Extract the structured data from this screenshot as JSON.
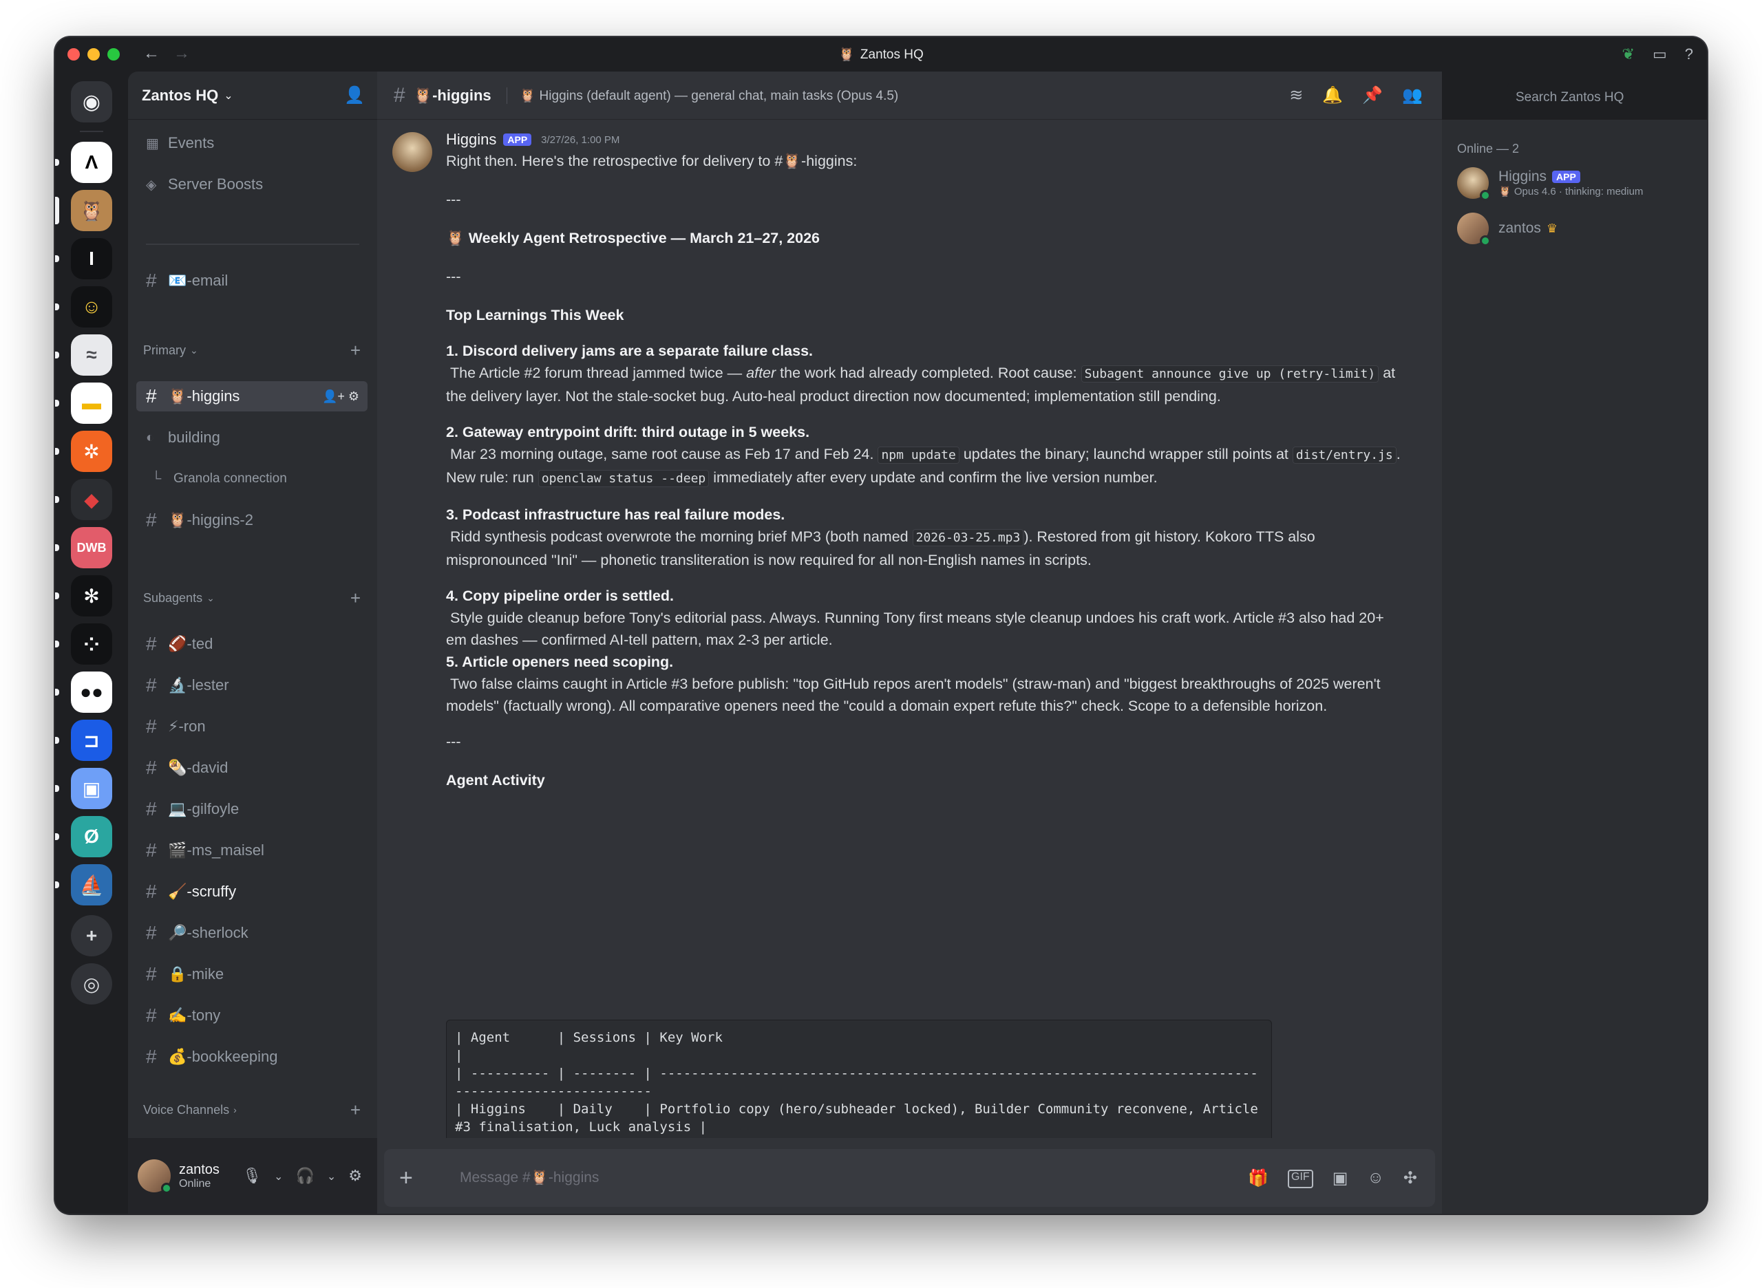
{
  "window": {
    "title": "Zantos HQ",
    "title_emoji": "🦉"
  },
  "servers": [
    {
      "label": "",
      "color": "#ffffff",
      "fg": "#000000",
      "glyph": "Λ"
    },
    {
      "label": "",
      "color": "#b7864f",
      "fg": "#ffffff",
      "glyph": "🦉"
    },
    {
      "label": "",
      "color": "#111214",
      "fg": "#ffffff",
      "glyph": "I"
    },
    {
      "label": "",
      "color": "#111214",
      "fg": "#ffd23f",
      "glyph": "☺"
    },
    {
      "label": "",
      "color": "#e8e9ec",
      "fg": "#4a4b50",
      "glyph": "≈"
    },
    {
      "label": "",
      "color": "#ffffff",
      "fg": "#f2b705",
      "glyph": "▬"
    },
    {
      "label": "",
      "color": "#f26522",
      "fg": "#ffffff",
      "glyph": "✲"
    },
    {
      "label": "",
      "color": "#2b2d31",
      "fg": "#e04040",
      "glyph": "◆"
    },
    {
      "label": "DWB",
      "color": "#e25c6a",
      "fg": "#ffffff",
      "glyph": "DWB"
    },
    {
      "label": "",
      "color": "#111214",
      "fg": "#ffffff",
      "glyph": "✻"
    },
    {
      "label": "",
      "color": "#111214",
      "fg": "#ffffff",
      "glyph": "⁘"
    },
    {
      "label": "",
      "color": "#ffffff",
      "fg": "#111214",
      "glyph": "●●"
    },
    {
      "label": "",
      "color": "#1b5ce6",
      "fg": "#ffffff",
      "glyph": "⊐"
    },
    {
      "label": "",
      "color": "#6e9ff7",
      "fg": "#ffffff",
      "glyph": "▣"
    },
    {
      "label": "",
      "color": "#2aa6a0",
      "fg": "#ffffff",
      "glyph": "Ø"
    },
    {
      "label": "",
      "color": "#2b6cb0",
      "fg": "#ffffff",
      "glyph": "⛵"
    }
  ],
  "server": {
    "name": "Zantos HQ"
  },
  "sidebar": {
    "events": "Events",
    "boosts": "Server Boosts",
    "email_channel": "📧-email",
    "primary_label": "Primary",
    "subagents_label": "Subagents",
    "voice_label": "Voice Channels",
    "primary": [
      {
        "name": "🦉-higgins",
        "active": true
      },
      {
        "name": "building",
        "forum": true
      },
      {
        "name": "Granola connection",
        "thread": true
      },
      {
        "name": "🦉-higgins-2"
      }
    ],
    "subagents": [
      {
        "name": "🏈-ted"
      },
      {
        "name": "🔬-lester"
      },
      {
        "name": "⚡-ron"
      },
      {
        "name": "🌯-david"
      },
      {
        "name": "💻-gilfoyle"
      },
      {
        "name": "🎬-ms_maisel"
      },
      {
        "name": "🧹-scruffy",
        "unread": true
      },
      {
        "name": "🔎-sherlock"
      },
      {
        "name": "🔒-mike"
      },
      {
        "name": "✍️-tony"
      },
      {
        "name": "💰-bookkeeping"
      }
    ]
  },
  "user": {
    "name": "zantos",
    "status": "Online"
  },
  "channel": {
    "title": "🦉-higgins",
    "topic": "🦉 Higgins (default agent) — general chat, main tasks (Opus 4.5)"
  },
  "search": {
    "placeholder": "Search Zantos HQ"
  },
  "message": {
    "author": "Higgins",
    "badge": "APP",
    "timestamp": "3/27/26, 1:00 PM",
    "intro": "Right then. Here's the retrospective for delivery to #🦉-higgins:",
    "rule": "---",
    "heading": "🦉 Weekly Agent Retrospective — March 21–27, 2026",
    "section_top": "Top Learnings This Week",
    "l1_title": "1. Discord delivery jams are a separate failure class.",
    "l1_a": "The Article #2 forum thread jammed twice — ",
    "l1_after": "after",
    "l1_b": " the work had already completed. Root cause: ",
    "l1_code": "Subagent announce give up (retry-limit)",
    "l1_c": " at the delivery layer. Not the stale-socket bug. Auto-heal product direction now documented; implementation still pending.",
    "l2_title": "2. Gateway entrypoint drift: third outage in 5 weeks.",
    "l2_a": "Mar 23 morning outage, same root cause as Feb 17 and Feb 24. ",
    "l2_code1": "npm update",
    "l2_b": " updates the binary; launchd wrapper still points at ",
    "l2_code2": "dist/entry.js",
    "l2_c": ". New rule: run ",
    "l2_code3": "openclaw status --deep",
    "l2_d": " immediately after every update and confirm the live version number.",
    "l3_title": "3. Podcast infrastructure has real failure modes.",
    "l3_a": "Ridd synthesis podcast overwrote the morning brief MP3 (both named ",
    "l3_code": "2026-03-25.mp3",
    "l3_b": "). Restored from git history. Kokoro TTS also mispronounced \"Ini\" — phonetic transliteration is now required for all non-English names in scripts.",
    "l4_title": "4. Copy pipeline order is settled.",
    "l4_a": "Style guide cleanup before Tony's editorial pass. Always. Running Tony first means style cleanup undoes his craft work. Article #3 also had 20+ em dashes — confirmed AI-tell pattern, max 2-3 per article.",
    "l5_title": "5. Article openers need scoping.",
    "l5_a": "Two false claims caught in Article #3 before publish: \"top GitHub repos aren't models\" (straw-man) and \"biggest breakthroughs of 2025 weren't models\" (factually wrong). All comparative openers need the \"could a domain expert refute this?\" check. Scope to a defensible horizon.",
    "section_activity": "Agent Activity",
    "table": "| Agent      | Sessions | Key Work\n|\n| ---------- | -------- | -----------------------------------------------------------------------------------------------------\n| Higgins    | Daily    | Portfolio copy (hero/subheader locked), Builder Community reconvene, Article #3 finalisation, Luck analysis |\n| Codex      | 10+      | Discord hardening, auto-compaction, two thread recoveries, NemoClaw eval, provider key fixes               |\n| Lester     | 3        | Article #3 research + validation\n|\n| Sherlock   | 1        | 10 source citations confirmed for Article #3"
  },
  "composer": {
    "placeholder": "Message #🦉-higgins"
  },
  "members": {
    "online_label": "Online — 2",
    "list": [
      {
        "name": "Higgins",
        "badge": "APP",
        "status": "🦉 Opus 4.6 · thinking: medium"
      },
      {
        "name": "zantos",
        "crown": "♛"
      }
    ]
  }
}
